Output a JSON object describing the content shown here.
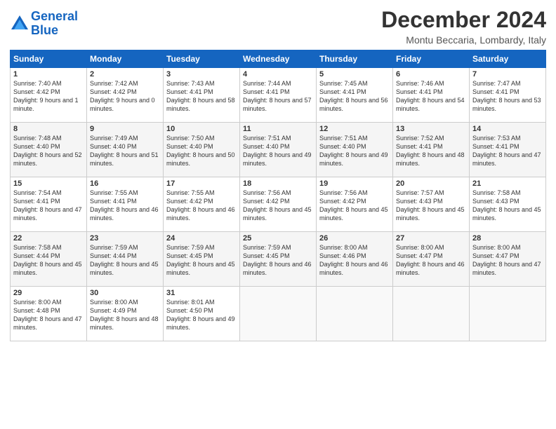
{
  "header": {
    "logo_line1": "General",
    "logo_line2": "Blue",
    "month": "December 2024",
    "location": "Montu Beccaria, Lombardy, Italy"
  },
  "days_of_week": [
    "Sunday",
    "Monday",
    "Tuesday",
    "Wednesday",
    "Thursday",
    "Friday",
    "Saturday"
  ],
  "weeks": [
    [
      {
        "day": "1",
        "sunrise": "Sunrise: 7:40 AM",
        "sunset": "Sunset: 4:42 PM",
        "daylight": "Daylight: 9 hours and 1 minute."
      },
      {
        "day": "2",
        "sunrise": "Sunrise: 7:42 AM",
        "sunset": "Sunset: 4:42 PM",
        "daylight": "Daylight: 9 hours and 0 minutes."
      },
      {
        "day": "3",
        "sunrise": "Sunrise: 7:43 AM",
        "sunset": "Sunset: 4:41 PM",
        "daylight": "Daylight: 8 hours and 58 minutes."
      },
      {
        "day": "4",
        "sunrise": "Sunrise: 7:44 AM",
        "sunset": "Sunset: 4:41 PM",
        "daylight": "Daylight: 8 hours and 57 minutes."
      },
      {
        "day": "5",
        "sunrise": "Sunrise: 7:45 AM",
        "sunset": "Sunset: 4:41 PM",
        "daylight": "Daylight: 8 hours and 56 minutes."
      },
      {
        "day": "6",
        "sunrise": "Sunrise: 7:46 AM",
        "sunset": "Sunset: 4:41 PM",
        "daylight": "Daylight: 8 hours and 54 minutes."
      },
      {
        "day": "7",
        "sunrise": "Sunrise: 7:47 AM",
        "sunset": "Sunset: 4:41 PM",
        "daylight": "Daylight: 8 hours and 53 minutes."
      }
    ],
    [
      {
        "day": "8",
        "sunrise": "Sunrise: 7:48 AM",
        "sunset": "Sunset: 4:40 PM",
        "daylight": "Daylight: 8 hours and 52 minutes."
      },
      {
        "day": "9",
        "sunrise": "Sunrise: 7:49 AM",
        "sunset": "Sunset: 4:40 PM",
        "daylight": "Daylight: 8 hours and 51 minutes."
      },
      {
        "day": "10",
        "sunrise": "Sunrise: 7:50 AM",
        "sunset": "Sunset: 4:40 PM",
        "daylight": "Daylight: 8 hours and 50 minutes."
      },
      {
        "day": "11",
        "sunrise": "Sunrise: 7:51 AM",
        "sunset": "Sunset: 4:40 PM",
        "daylight": "Daylight: 8 hours and 49 minutes."
      },
      {
        "day": "12",
        "sunrise": "Sunrise: 7:51 AM",
        "sunset": "Sunset: 4:40 PM",
        "daylight": "Daylight: 8 hours and 49 minutes."
      },
      {
        "day": "13",
        "sunrise": "Sunrise: 7:52 AM",
        "sunset": "Sunset: 4:41 PM",
        "daylight": "Daylight: 8 hours and 48 minutes."
      },
      {
        "day": "14",
        "sunrise": "Sunrise: 7:53 AM",
        "sunset": "Sunset: 4:41 PM",
        "daylight": "Daylight: 8 hours and 47 minutes."
      }
    ],
    [
      {
        "day": "15",
        "sunrise": "Sunrise: 7:54 AM",
        "sunset": "Sunset: 4:41 PM",
        "daylight": "Daylight: 8 hours and 47 minutes."
      },
      {
        "day": "16",
        "sunrise": "Sunrise: 7:55 AM",
        "sunset": "Sunset: 4:41 PM",
        "daylight": "Daylight: 8 hours and 46 minutes."
      },
      {
        "day": "17",
        "sunrise": "Sunrise: 7:55 AM",
        "sunset": "Sunset: 4:42 PM",
        "daylight": "Daylight: 8 hours and 46 minutes."
      },
      {
        "day": "18",
        "sunrise": "Sunrise: 7:56 AM",
        "sunset": "Sunset: 4:42 PM",
        "daylight": "Daylight: 8 hours and 45 minutes."
      },
      {
        "day": "19",
        "sunrise": "Sunrise: 7:56 AM",
        "sunset": "Sunset: 4:42 PM",
        "daylight": "Daylight: 8 hours and 45 minutes."
      },
      {
        "day": "20",
        "sunrise": "Sunrise: 7:57 AM",
        "sunset": "Sunset: 4:43 PM",
        "daylight": "Daylight: 8 hours and 45 minutes."
      },
      {
        "day": "21",
        "sunrise": "Sunrise: 7:58 AM",
        "sunset": "Sunset: 4:43 PM",
        "daylight": "Daylight: 8 hours and 45 minutes."
      }
    ],
    [
      {
        "day": "22",
        "sunrise": "Sunrise: 7:58 AM",
        "sunset": "Sunset: 4:44 PM",
        "daylight": "Daylight: 8 hours and 45 minutes."
      },
      {
        "day": "23",
        "sunrise": "Sunrise: 7:59 AM",
        "sunset": "Sunset: 4:44 PM",
        "daylight": "Daylight: 8 hours and 45 minutes."
      },
      {
        "day": "24",
        "sunrise": "Sunrise: 7:59 AM",
        "sunset": "Sunset: 4:45 PM",
        "daylight": "Daylight: 8 hours and 45 minutes."
      },
      {
        "day": "25",
        "sunrise": "Sunrise: 7:59 AM",
        "sunset": "Sunset: 4:45 PM",
        "daylight": "Daylight: 8 hours and 46 minutes."
      },
      {
        "day": "26",
        "sunrise": "Sunrise: 8:00 AM",
        "sunset": "Sunset: 4:46 PM",
        "daylight": "Daylight: 8 hours and 46 minutes."
      },
      {
        "day": "27",
        "sunrise": "Sunrise: 8:00 AM",
        "sunset": "Sunset: 4:47 PM",
        "daylight": "Daylight: 8 hours and 46 minutes."
      },
      {
        "day": "28",
        "sunrise": "Sunrise: 8:00 AM",
        "sunset": "Sunset: 4:47 PM",
        "daylight": "Daylight: 8 hours and 47 minutes."
      }
    ],
    [
      {
        "day": "29",
        "sunrise": "Sunrise: 8:00 AM",
        "sunset": "Sunset: 4:48 PM",
        "daylight": "Daylight: 8 hours and 47 minutes."
      },
      {
        "day": "30",
        "sunrise": "Sunrise: 8:00 AM",
        "sunset": "Sunset: 4:49 PM",
        "daylight": "Daylight: 8 hours and 48 minutes."
      },
      {
        "day": "31",
        "sunrise": "Sunrise: 8:01 AM",
        "sunset": "Sunset: 4:50 PM",
        "daylight": "Daylight: 8 hours and 49 minutes."
      },
      null,
      null,
      null,
      null
    ]
  ]
}
